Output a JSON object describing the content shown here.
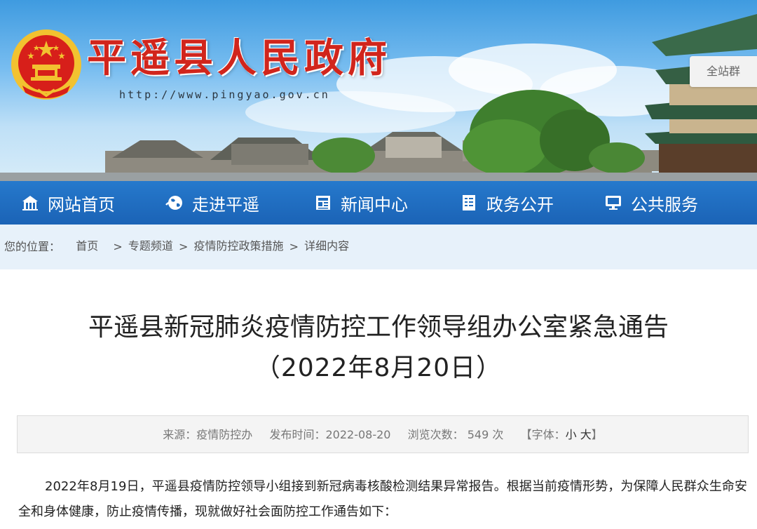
{
  "header": {
    "site_title": "平遥县人民政府",
    "site_url": "http://www.pingyao.gov.cn",
    "site_group_label": "全站群"
  },
  "nav": {
    "items": [
      {
        "label": "网站首页",
        "icon": "home-icon"
      },
      {
        "label": "走进平遥",
        "icon": "globe-icon"
      },
      {
        "label": "新闻中心",
        "icon": "newspaper-icon"
      },
      {
        "label": "政务公开",
        "icon": "document-icon"
      },
      {
        "label": "公共服务",
        "icon": "monitor-icon"
      }
    ]
  },
  "breadcrumb": {
    "label": "您的位置：",
    "items": [
      "首页",
      "专题频道",
      "疫情防控政策措施",
      "详细内容"
    ],
    "separator": ">"
  },
  "article": {
    "title_line1": "平遥县新冠肺炎疫情防控工作领导组办公室紧急通告",
    "title_line2": "（2022年8月20日）",
    "source_label": "来源：",
    "source": "疫情防控办",
    "publish_label": "发布时间：",
    "publish_date": "2022-08-20",
    "views_label": "浏览次数：",
    "views": "549",
    "views_unit": "次",
    "font_label_open": "【字体：",
    "font_small": "小",
    "font_large": "大",
    "font_label_close": "】",
    "paragraph1": "2022年8月19日，平遥县疫情防控领导小组接到新冠病毒核酸检测结果异常报告。根据当前疫情形势，为保障人民群众生命安全和身体健康，防止疫情传播，现就做好社会面防控工作通告如下："
  },
  "colors": {
    "nav_bg": "#1b63b6",
    "title_red": "#d1251c",
    "breadcrumb_bg": "#e7f1fa",
    "emblem_red": "#d71f1a",
    "emblem_gold": "#f2c230"
  }
}
